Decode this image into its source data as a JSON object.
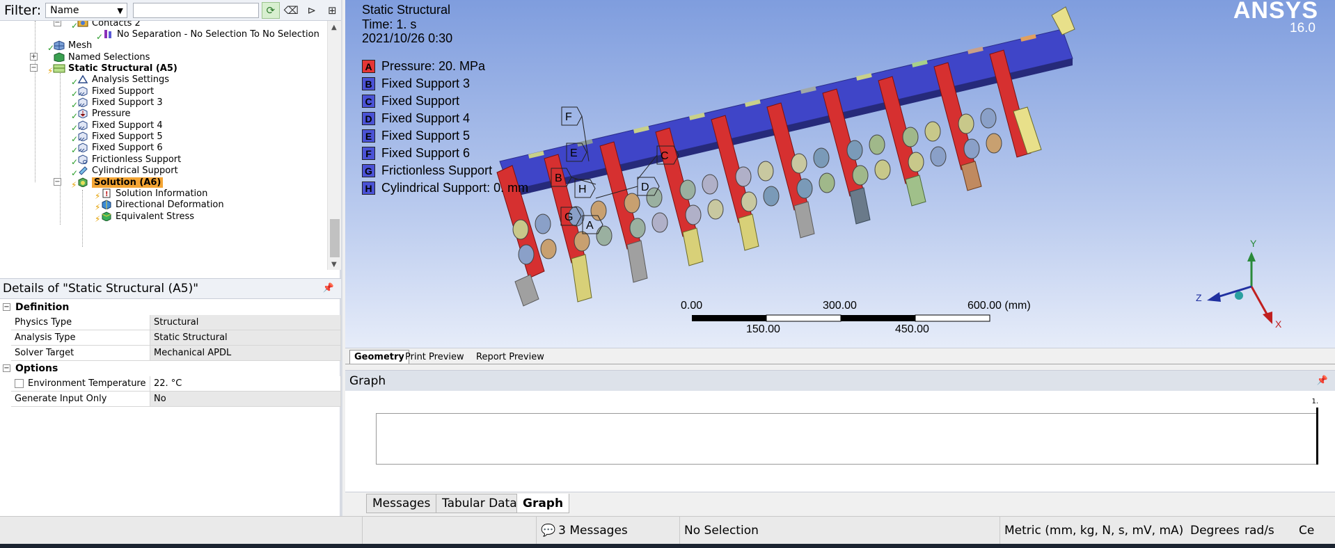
{
  "filter": {
    "label": "Filter:",
    "selected": "Name"
  },
  "tree": {
    "items": [
      {
        "label": "Contacts 2"
      },
      {
        "label": "No Separation - No Selection To No Selection"
      },
      {
        "label": "Mesh"
      },
      {
        "label": "Named Selections"
      },
      {
        "label": "Static Structural (A5)"
      },
      {
        "label": "Analysis Settings"
      },
      {
        "label": "Fixed Support"
      },
      {
        "label": "Fixed Support 3"
      },
      {
        "label": "Pressure"
      },
      {
        "label": "Fixed Support 4"
      },
      {
        "label": "Fixed Support 5"
      },
      {
        "label": "Fixed Support 6"
      },
      {
        "label": "Frictionless Support"
      },
      {
        "label": "Cylindrical Support"
      },
      {
        "label": "Solution (A6)"
      },
      {
        "label": "Solution Information"
      },
      {
        "label": "Directional Deformation"
      },
      {
        "label": "Equivalent Stress"
      }
    ]
  },
  "details": {
    "title": "Details of \"Static Structural (A5)\"",
    "groups": [
      {
        "name": "Definition",
        "rows": [
          {
            "key": "Physics Type",
            "value": "Structural"
          },
          {
            "key": "Analysis Type",
            "value": "Static Structural"
          },
          {
            "key": "Solver Target",
            "value": "Mechanical APDL"
          }
        ]
      },
      {
        "name": "Options",
        "rows": [
          {
            "key": "Environment Temperature",
            "value": "22. °C"
          },
          {
            "key": "Generate Input Only",
            "value": "No"
          }
        ]
      }
    ]
  },
  "viewport": {
    "title": "Static Structural",
    "time": "Time: 1. s",
    "date": "2021/10/26 0:30",
    "brand": "ANSYS",
    "version": "16.0",
    "legend": [
      {
        "letter": "A",
        "label": "Pressure: 20. MPa",
        "color": "#e53535"
      },
      {
        "letter": "B",
        "label": "Fixed Support 3",
        "color": "#4a52d6"
      },
      {
        "letter": "C",
        "label": "Fixed Support",
        "color": "#4a52d6"
      },
      {
        "letter": "D",
        "label": "Fixed Support 4",
        "color": "#4a52d6"
      },
      {
        "letter": "E",
        "label": "Fixed Support 5",
        "color": "#4a52d6"
      },
      {
        "letter": "F",
        "label": "Fixed Support 6",
        "color": "#4a52d6"
      },
      {
        "letter": "G",
        "label": "Frictionless Support",
        "color": "#4a52d6"
      },
      {
        "letter": "H",
        "label": "Cylindrical Support: 0. mm",
        "color": "#4a52d6"
      }
    ],
    "scale": {
      "top_labels": [
        "0.00",
        "300.00",
        "600.00 (mm)"
      ],
      "bottom_labels": [
        "150.00",
        "450.00"
      ]
    },
    "triad": {
      "x": "X",
      "y": "Y",
      "z": "Z"
    },
    "tabs": [
      "Geometry",
      "Print Preview",
      "Report Preview"
    ]
  },
  "graph": {
    "title": "Graph",
    "tick": "1."
  },
  "bottom_tabs": [
    "Messages",
    "Tabular Data",
    "Graph"
  ],
  "status": {
    "messages": "3 Messages",
    "selection": "No Selection",
    "units": "Metric (mm, kg, N, s, mV, mA)",
    "angle": "Degrees",
    "rate": "rad/s",
    "temp": "Ce"
  }
}
